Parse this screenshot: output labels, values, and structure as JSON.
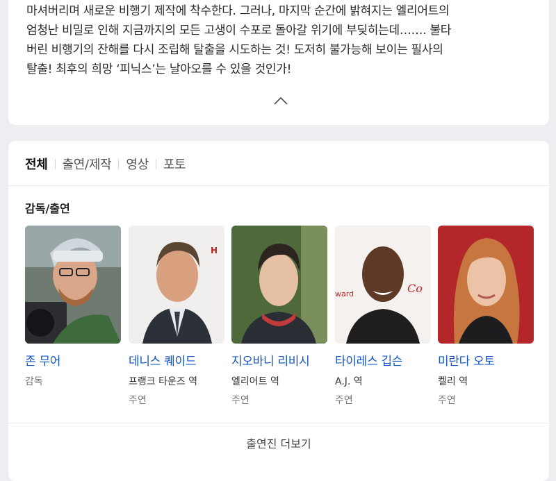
{
  "synopsis": {
    "lines": [
      "마셔버리며 새로운 비행기 제작에 착수한다. 그러나, 마지막 순간에 밝혀지는 엘리어트의",
      "엄청난 비밀로 인해 지금까지의 모든 고생이 수포로 돌아갈 위기에 부딪히는데……. 불타",
      "버린 비행기의 잔해를 다시 조립해 탈출을 시도하는 것! 도저히 불가능해 보이는 필사의",
      "탈출! 최후의 희망 ‘피닉스’는 날아오를 수 있을 것인가!"
    ],
    "collapse_icon": "chevron-up-icon"
  },
  "tabs": [
    {
      "label": "전체",
      "active": true
    },
    {
      "label": "출연/제작",
      "active": false
    },
    {
      "label": "영상",
      "active": false
    },
    {
      "label": "포토",
      "active": false
    }
  ],
  "section_title": "감독/출연",
  "cast": [
    {
      "name": "존 무어",
      "role": "",
      "kind": "감독"
    },
    {
      "name": "데니스 퀘이드",
      "role": "프랭크 타운즈 역",
      "kind": "주연"
    },
    {
      "name": "지오바니 리비시",
      "role": "엘리어트 역",
      "kind": "주연"
    },
    {
      "name": "타이레스 깁슨",
      "role": "A.J. 역",
      "kind": "주연"
    },
    {
      "name": "미란다 오토",
      "role": "켈리 역",
      "kind": "주연"
    }
  ],
  "more_label": "출연진 더보기",
  "colors": {
    "link": "#1556c5",
    "background": "#eceef2",
    "card": "#ffffff"
  }
}
